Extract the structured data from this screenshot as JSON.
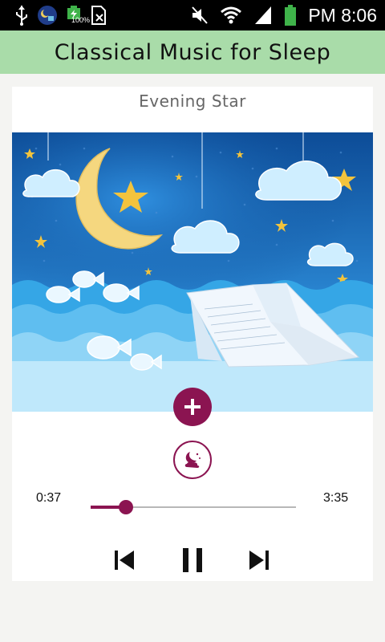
{
  "status_bar": {
    "battery_percent": "100%",
    "time": "PM 8:06"
  },
  "app": {
    "title": "Classical Music for Sleep"
  },
  "player": {
    "track_title": "Evening Star",
    "elapsed": "0:37",
    "total": "3:35",
    "progress": 0.172,
    "state": "playing"
  },
  "colors": {
    "accent": "#8b1451",
    "app_bar": "#a9dca9"
  },
  "icons": {
    "add": "add-icon",
    "mode": "sleep-moon-icon",
    "prev": "skip-previous-icon",
    "play_pause": "pause-icon",
    "next": "skip-next-icon"
  }
}
